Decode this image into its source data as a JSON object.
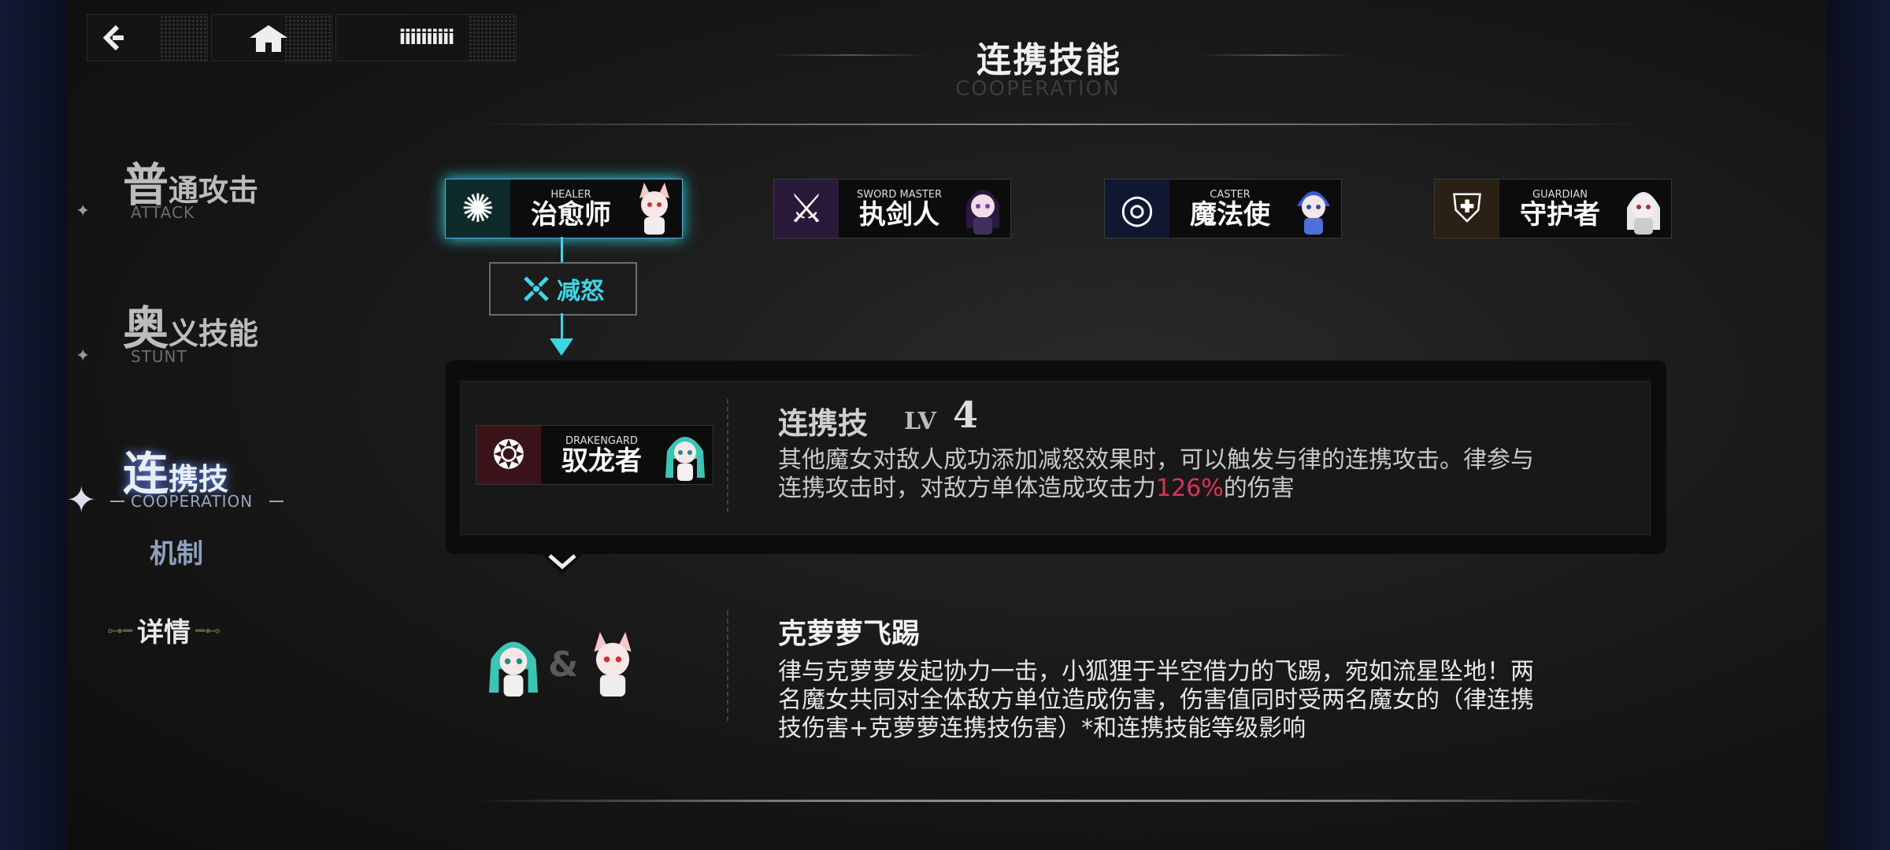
{
  "nav": {
    "back_label": "‹",
    "home_label": "⌂",
    "menu_label": "iiiiiiiiii"
  },
  "header": {
    "title": "连携技能",
    "subtitle": "COOPERATION"
  },
  "sidebar": {
    "items": [
      {
        "big": "普",
        "rest": "通攻击",
        "en": "ATTACK"
      },
      {
        "big": "奥",
        "rest": "义技能",
        "en": "STUNT"
      },
      {
        "big": "连",
        "rest": "携技",
        "en": "COOPERATION"
      },
      {
        "label": "机制"
      },
      {
        "label": "详情"
      }
    ]
  },
  "classes": [
    {
      "en": "HEALER",
      "cn": "治愈师",
      "icon": "healer-emblem-icon",
      "color": "#0f2a2a"
    },
    {
      "en": "SWORD MASTER",
      "cn": "执剑人",
      "icon": "sword-master-emblem-icon",
      "color": "#2a1a3a"
    },
    {
      "en": "CASTER",
      "cn": "魔法使",
      "icon": "caster-emblem-icon",
      "color": "#0f1830"
    },
    {
      "en": "GUARDIAN",
      "cn": "守护者",
      "icon": "guardian-emblem-icon",
      "color": "#2a2114"
    }
  ],
  "tag": {
    "label": "减怒",
    "accent": "#3cd6e4"
  },
  "combo": {
    "class_en": "DRAKENGARD",
    "class_cn": "驭龙者",
    "skill_name": "连携技",
    "lv_label": "LV",
    "lv_value": "4",
    "desc_before": "其他魔女对敌人成功添加减怒效果时，可以触发与律的连携攻击。律参与",
    "desc_line2_before": "连携攻击时，对敌方单体造成攻击力",
    "desc_highlight": "126%",
    "desc_after": "的伤害",
    "highlight_color": "#e0315a"
  },
  "skill2": {
    "amp": "&",
    "name": "克萝萝飞踢",
    "desc_line1": "律与克萝萝发起协力一击，小狐狸于半空借力的飞踢，宛如流星坠地！两",
    "desc_line2": "名魔女共同对全体敌方单位造成伤害，伤害值同时受两名魔女的（律连携",
    "desc_line3": "技伤害+克萝萝连携技伤害）*和连携技能等级影响"
  }
}
